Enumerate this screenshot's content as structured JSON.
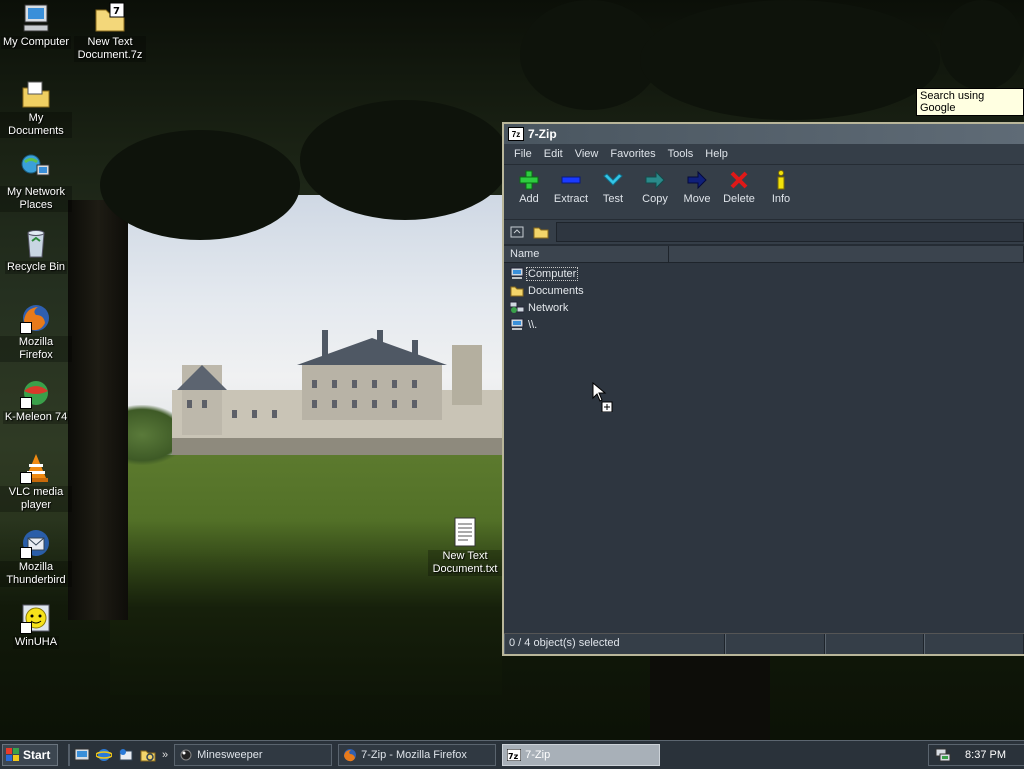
{
  "desktop": {
    "icons": [
      {
        "label": "My Computer",
        "icon": "my-computer-icon"
      },
      {
        "label": "New Text Document.7z",
        "icon": "archive-file-icon"
      },
      {
        "label": "My Documents",
        "icon": "my-documents-icon"
      },
      {
        "label": "My Network Places",
        "icon": "network-places-icon"
      },
      {
        "label": "Recycle Bin",
        "icon": "recycle-bin-icon"
      },
      {
        "label": "Mozilla Firefox",
        "icon": "firefox-icon"
      },
      {
        "label": "K-Meleon 74",
        "icon": "k-meleon-icon"
      },
      {
        "label": "VLC media player",
        "icon": "vlc-icon"
      },
      {
        "label": "Mozilla Thunderbird",
        "icon": "thunderbird-icon"
      },
      {
        "label": "WinUHA",
        "icon": "winuha-icon"
      },
      {
        "label": "New Text Document.txt",
        "icon": "text-file-icon"
      }
    ]
  },
  "tooltip": {
    "text": "Search using Google"
  },
  "window": {
    "title": "7-Zip",
    "app_icon_text": "7z",
    "menu": [
      "File",
      "Edit",
      "View",
      "Favorites",
      "Tools",
      "Help"
    ],
    "toolbar": [
      {
        "label": "Add",
        "icon": "add-icon",
        "color": "#2ecc40"
      },
      {
        "label": "Extract",
        "icon": "extract-icon",
        "color": "#1a3aff"
      },
      {
        "label": "Test",
        "icon": "test-icon",
        "color": "#34c6e8"
      },
      {
        "label": "Copy",
        "icon": "copy-icon",
        "color": "#2a8a8a"
      },
      {
        "label": "Move",
        "icon": "move-icon",
        "color": "#10207a"
      },
      {
        "label": "Delete",
        "icon": "delete-icon",
        "color": "#e01818"
      },
      {
        "label": "Info",
        "icon": "info-icon",
        "color": "#f2e20a"
      }
    ],
    "list": {
      "columns": [
        "Name"
      ],
      "rows": [
        {
          "name": "Computer",
          "icon": "computer-icon"
        },
        {
          "name": "Documents",
          "icon": "folder-icon"
        },
        {
          "name": "Network",
          "icon": "network-icon"
        },
        {
          "name": "\\\\.",
          "icon": "device-icon"
        }
      ]
    },
    "status": {
      "selection": "0 / 4 object(s) selected"
    }
  },
  "taskbar": {
    "start_label": "Start",
    "tasks": [
      {
        "label": "Minesweeper",
        "icon": "minesweeper-icon",
        "active": false
      },
      {
        "label": "7-Zip - Mozilla Firefox",
        "icon": "firefox-icon",
        "active": false
      },
      {
        "label": "7-Zip",
        "icon": "7zip-icon",
        "active": true
      }
    ],
    "clock": "8:37 PM"
  }
}
